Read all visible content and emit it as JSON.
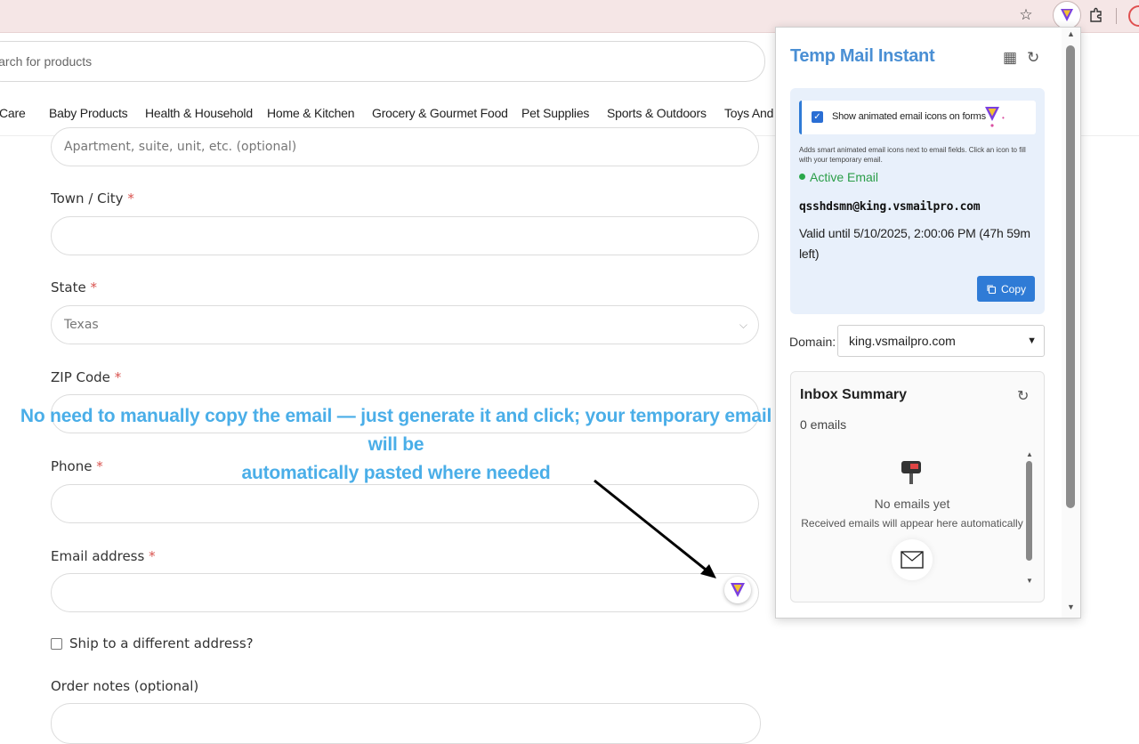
{
  "browser": {
    "star_icon": "star-icon",
    "extension_icon": "temp-mail-extension-icon",
    "puzzle_icon": "extensions-puzzle-icon"
  },
  "site": {
    "search_placeholder": "Search for products",
    "categories": [
      "Care",
      "Baby Products",
      "Health & Household",
      "Home & Kitchen",
      "Grocery & Gourmet Food",
      "Pet Supplies",
      "Sports & Outdoors",
      "Toys And G"
    ]
  },
  "form": {
    "apartment_placeholder": "Apartment, suite, unit, etc. (optional)",
    "town_label": "Town / City",
    "state_label": "State",
    "state_value": "Texas",
    "zip_label": "ZIP Code",
    "phone_label": "Phone",
    "email_label": "Email address",
    "required_mark": "*",
    "ship_label": "Ship to a different address?",
    "notes_label": "Order notes (optional)"
  },
  "annotation": {
    "line1": "No need to manually copy the email — just generate it and click; your temporary email will be",
    "line2": "automatically pasted where needed"
  },
  "popup": {
    "title": "Temp Mail Instant",
    "toggle_label": "Show animated email icons on forms",
    "toggle_checked": true,
    "help_text": "Adds smart animated email icons next to email fields. Click an icon to fill with your temporary email.",
    "status": "Active Email",
    "email": "qsshdsmn@king.vsmailpro.com",
    "valid_text": "Valid until 5/10/2025, 2:00:06 PM (47h 59m left)",
    "copy_label": "Copy",
    "domain_label": "Domain:",
    "domain_value": "king.vsmailpro.com",
    "inbox_title": "Inbox Summary",
    "inbox_count": "0 emails",
    "empty_title": "No emails yet",
    "empty_sub": "Received emails will appear here automatically"
  },
  "colors": {
    "accent": "#4a8fd4",
    "button": "#2f7bd6",
    "annotation": "#4aaee8",
    "status_green": "#2a9d48",
    "required_red": "#d9534f"
  }
}
